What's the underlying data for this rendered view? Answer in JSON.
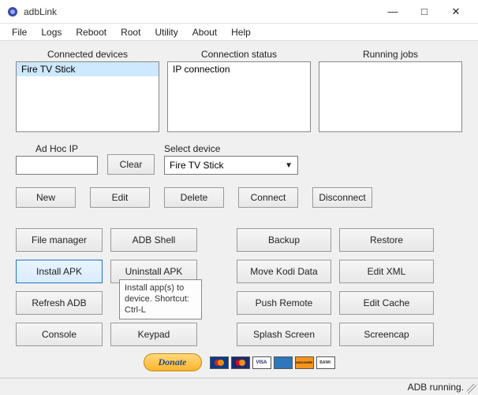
{
  "app": {
    "title": "adbLink"
  },
  "menu": {
    "file": "File",
    "logs": "Logs",
    "reboot": "Reboot",
    "root": "Root",
    "utility": "Utility",
    "about": "About",
    "help": "Help"
  },
  "panels": {
    "connected": {
      "label": "Connected devices",
      "item0": "Fire TV Stick"
    },
    "status": {
      "label": "Connection status",
      "item0": "IP connection"
    },
    "jobs": {
      "label": "Running jobs"
    }
  },
  "adhoc": {
    "label": "Ad Hoc IP",
    "value": ""
  },
  "clear": "Clear",
  "select_device": {
    "label": "Select device",
    "value": "Fire TV Stick"
  },
  "row": {
    "new": "New",
    "edit": "Edit",
    "delete": "Delete",
    "connect": "Connect",
    "disconnect": "Disconnect"
  },
  "grid": {
    "filemanager": "File manager",
    "adbshell": "ADB Shell",
    "backup": "Backup",
    "restore": "Restore",
    "installapk": "Install APK",
    "uninstallapk": "Uninstall APK",
    "movekodi": "Move Kodi Data",
    "editxml": "Edit XML",
    "refreshadb": "Refresh ADB",
    "pushremote": "Push Remote",
    "editcache": "Edit Cache",
    "console": "Console",
    "keypad": "Keypad",
    "splash": "Splash Screen",
    "screencap": "Screencap"
  },
  "tooltip": "Install app(s) to device. Shortcut: Ctrl-L",
  "donate": "Donate",
  "cards": {
    "maestro": "",
    "mc": "",
    "visa": "VISA",
    "amex": "",
    "discover": "DISCOVER",
    "bank": "BANK"
  },
  "status_text": "ADB running."
}
